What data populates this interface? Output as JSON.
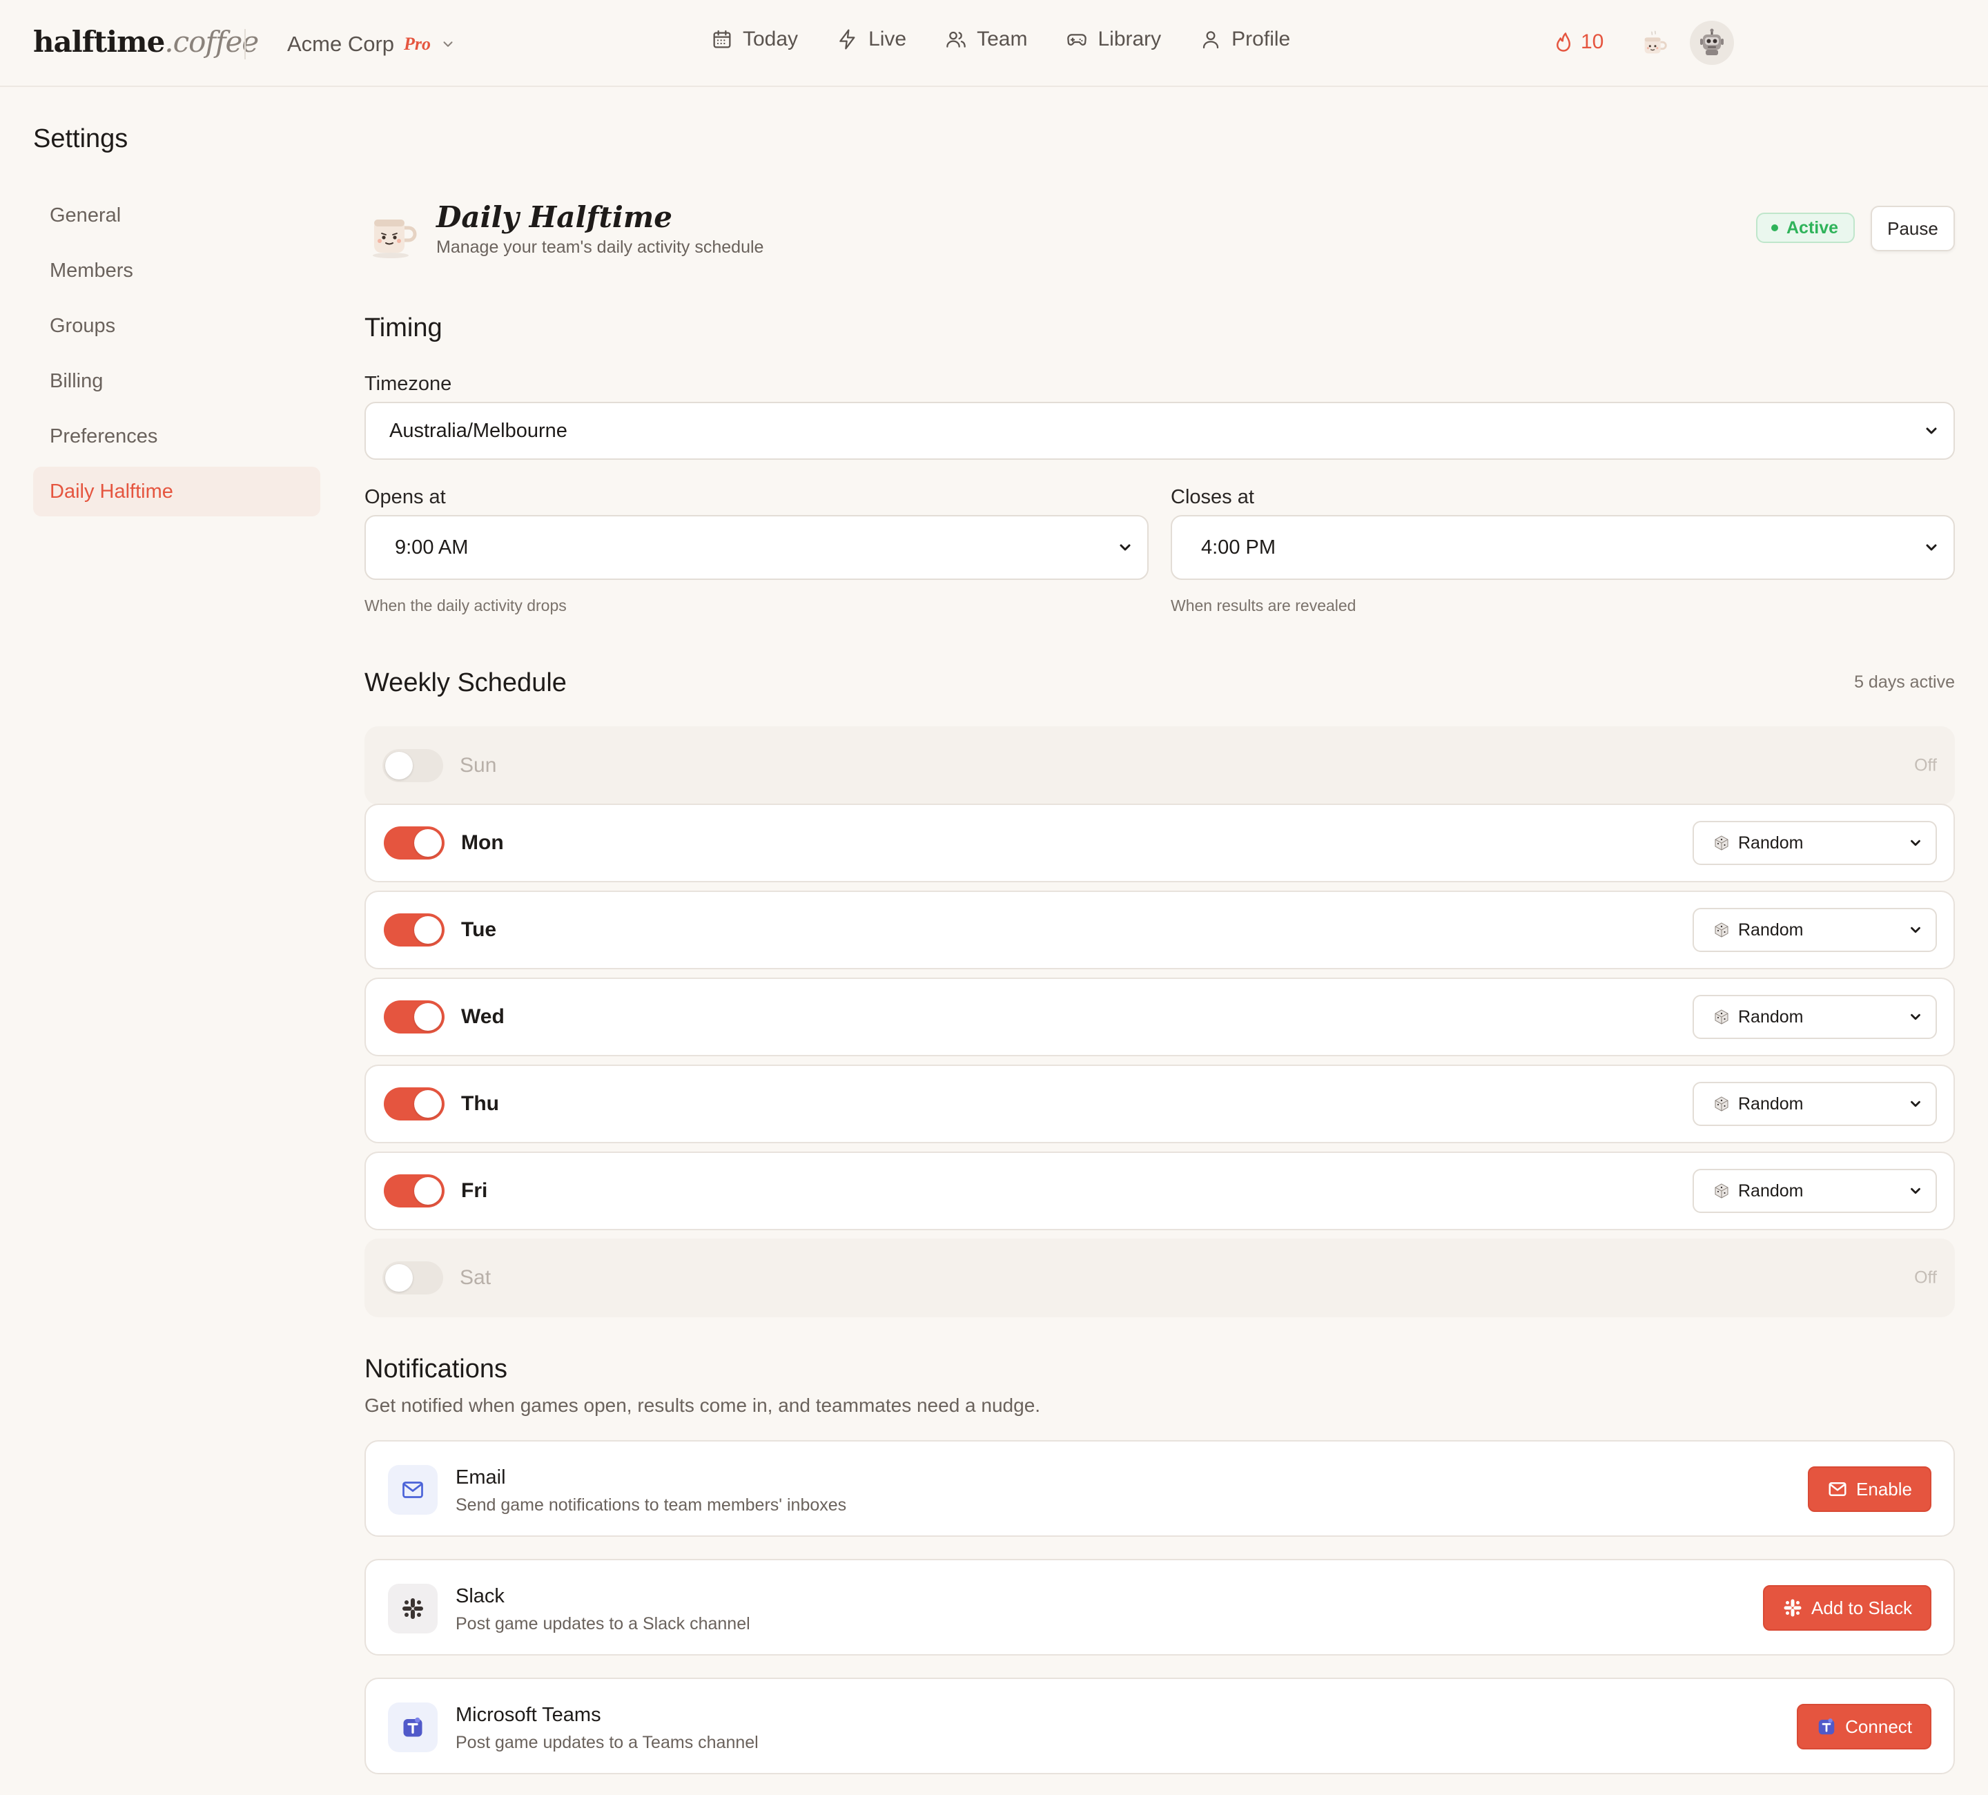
{
  "brand": {
    "name": "halftime",
    "suffix": ".coffee"
  },
  "org": {
    "name": "Acme Corp",
    "plan": "Pro"
  },
  "nav": [
    {
      "label": "Today",
      "icon": "calendar-icon"
    },
    {
      "label": "Live",
      "icon": "bolt-icon"
    },
    {
      "label": "Team",
      "icon": "users-icon"
    },
    {
      "label": "Library",
      "icon": "gamepad-icon"
    },
    {
      "label": "Profile",
      "icon": "user-icon"
    }
  ],
  "streak": {
    "count": "10",
    "icon": "flame-icon"
  },
  "sidebar": {
    "title": "Settings",
    "items": [
      {
        "label": "General"
      },
      {
        "label": "Members"
      },
      {
        "label": "Groups"
      },
      {
        "label": "Billing"
      },
      {
        "label": "Preferences"
      },
      {
        "label": "Daily Halftime",
        "active": true
      }
    ]
  },
  "page": {
    "title": "Daily Halftime",
    "subtitle": "Manage your team's daily activity schedule",
    "status": "Active",
    "pause_label": "Pause"
  },
  "timing": {
    "title": "Timing",
    "timezone_label": "Timezone",
    "timezone_value": "Australia/Melbourne",
    "opens_label": "Opens at",
    "opens_value": "9:00 AM",
    "opens_help": "When the daily activity drops",
    "closes_label": "Closes at",
    "closes_value": "4:00 PM",
    "closes_help": "When results are revealed"
  },
  "schedule": {
    "title": "Weekly Schedule",
    "summary": "5 days active",
    "days": [
      {
        "name": "Sun",
        "enabled": false,
        "state": "Off"
      },
      {
        "name": "Mon",
        "enabled": true,
        "game": "Random"
      },
      {
        "name": "Tue",
        "enabled": true,
        "game": "Random"
      },
      {
        "name": "Wed",
        "enabled": true,
        "game": "Random"
      },
      {
        "name": "Thu",
        "enabled": true,
        "game": "Random"
      },
      {
        "name": "Fri",
        "enabled": true,
        "game": "Random"
      },
      {
        "name": "Sat",
        "enabled": false,
        "state": "Off"
      }
    ]
  },
  "notifications": {
    "title": "Notifications",
    "description": "Get notified when games open, results come in, and teammates need a nudge.",
    "channels": [
      {
        "name": "Email",
        "description": "Send game notifications to team members' inboxes",
        "button": "Enable",
        "icon": "mail-icon"
      },
      {
        "name": "Slack",
        "description": "Post game updates to a Slack channel",
        "button": "Add to Slack",
        "icon": "slack-icon"
      },
      {
        "name": "Microsoft Teams",
        "description": "Post game updates to a Teams channel",
        "button": "Connect",
        "icon": "teams-icon"
      }
    ]
  },
  "colors": {
    "accent": "#e5553f",
    "background": "#faf7f3",
    "active_green": "#2fb35a"
  }
}
